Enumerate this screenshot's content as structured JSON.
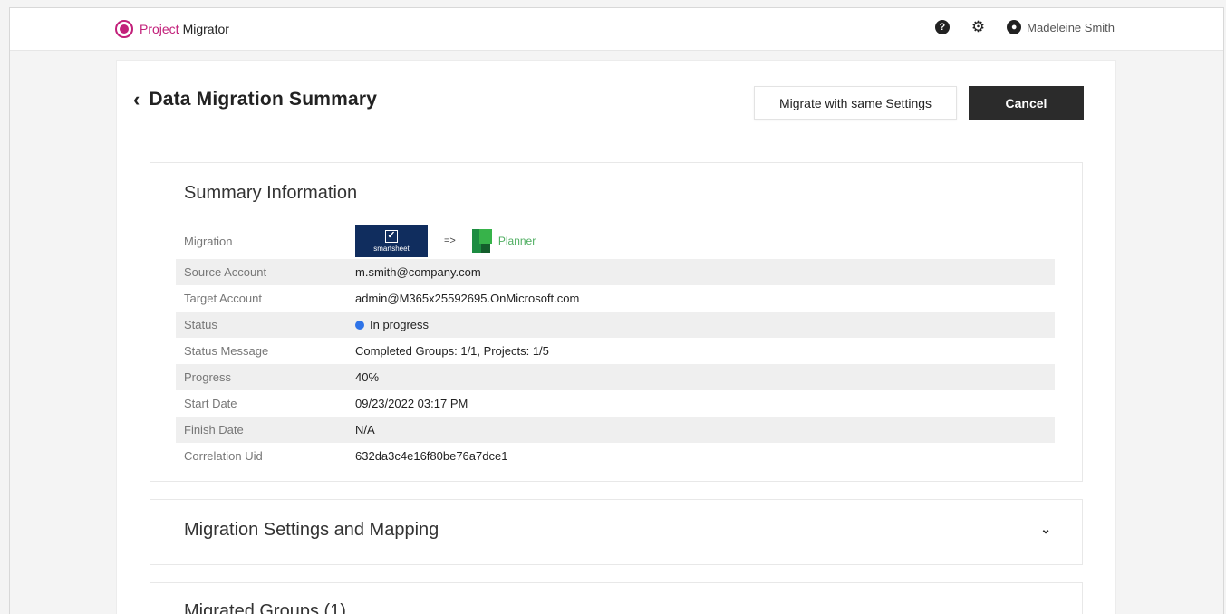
{
  "app": {
    "brand_part1": "Project",
    "brand_part2": "Migrator"
  },
  "header": {
    "help_icon": "?",
    "settings_icon": "gear-icon",
    "user_name": "Madeleine Smith"
  },
  "page": {
    "title": "Data Migration Summary",
    "migrate_same_label": "Migrate with same Settings",
    "cancel_label": "Cancel"
  },
  "summary": {
    "title": "Summary Information",
    "migration": {
      "label": "Migration",
      "source_logo_text": "smartsheet",
      "arrow": "=>",
      "target_name": "Planner"
    },
    "rows": [
      {
        "label": "Source Account",
        "value": "m.smith@company.com"
      },
      {
        "label": "Target Account",
        "value": "admin@M365x25592695.OnMicrosoft.com"
      },
      {
        "label": "Status",
        "value": "In progress"
      },
      {
        "label": "Status Message",
        "value": "Completed Groups: 1/1, Projects: 1/5"
      },
      {
        "label": "Progress",
        "value": "40%"
      },
      {
        "label": "Start Date",
        "value": "09/23/2022 03:17 PM"
      },
      {
        "label": "Finish Date",
        "value": "N/A"
      },
      {
        "label": "Correlation Uid",
        "value": "632da3c4e16f80be76a7dce1"
      }
    ]
  },
  "settings_section": {
    "title": "Migration Settings and Mapping"
  },
  "groups_section": {
    "title": "Migrated Groups (1)"
  },
  "colors": {
    "brand": "#c2207a",
    "status_in_progress": "#2f74e8",
    "dark_button": "#2b2b2b",
    "smartsheet_bg": "#102d5e",
    "planner_green": "#37b34a"
  }
}
